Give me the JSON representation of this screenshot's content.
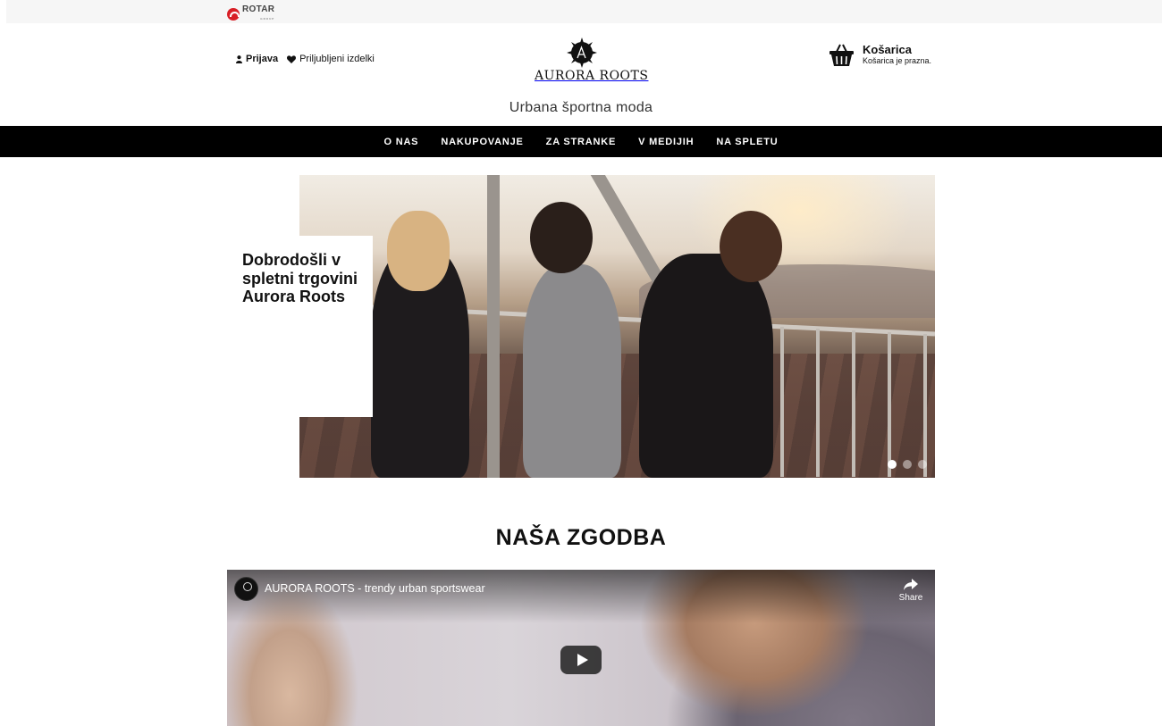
{
  "topbar": {
    "brand_name": "ROTAR",
    "brand_sub": "GROUP",
    "brand_color": "#d81f26"
  },
  "header": {
    "login_label": "Prijava",
    "favorites_label": "Priljubljeni izdelki",
    "logo_text": "AURORA ROOTS",
    "tagline": "Urbana športna moda",
    "cart": {
      "title": "Košarica",
      "status": "Košarica je prazna."
    }
  },
  "nav": {
    "items": [
      {
        "label": "O NAS"
      },
      {
        "label": "NAKUPOVANJE"
      },
      {
        "label": "ZA STRANKE"
      },
      {
        "label": "V MEDIJIH"
      },
      {
        "label": "NA SPLETU"
      }
    ],
    "background": "#000000"
  },
  "hero": {
    "heading": "Dobrodošli v spletni trgovini Aurora Roots",
    "slides_count": 3,
    "active_slide": 1
  },
  "story": {
    "title": "NAŠA ZGODBA",
    "video": {
      "title": "AURORA ROOTS - trendy urban sportswear",
      "share_label": "Share"
    }
  }
}
